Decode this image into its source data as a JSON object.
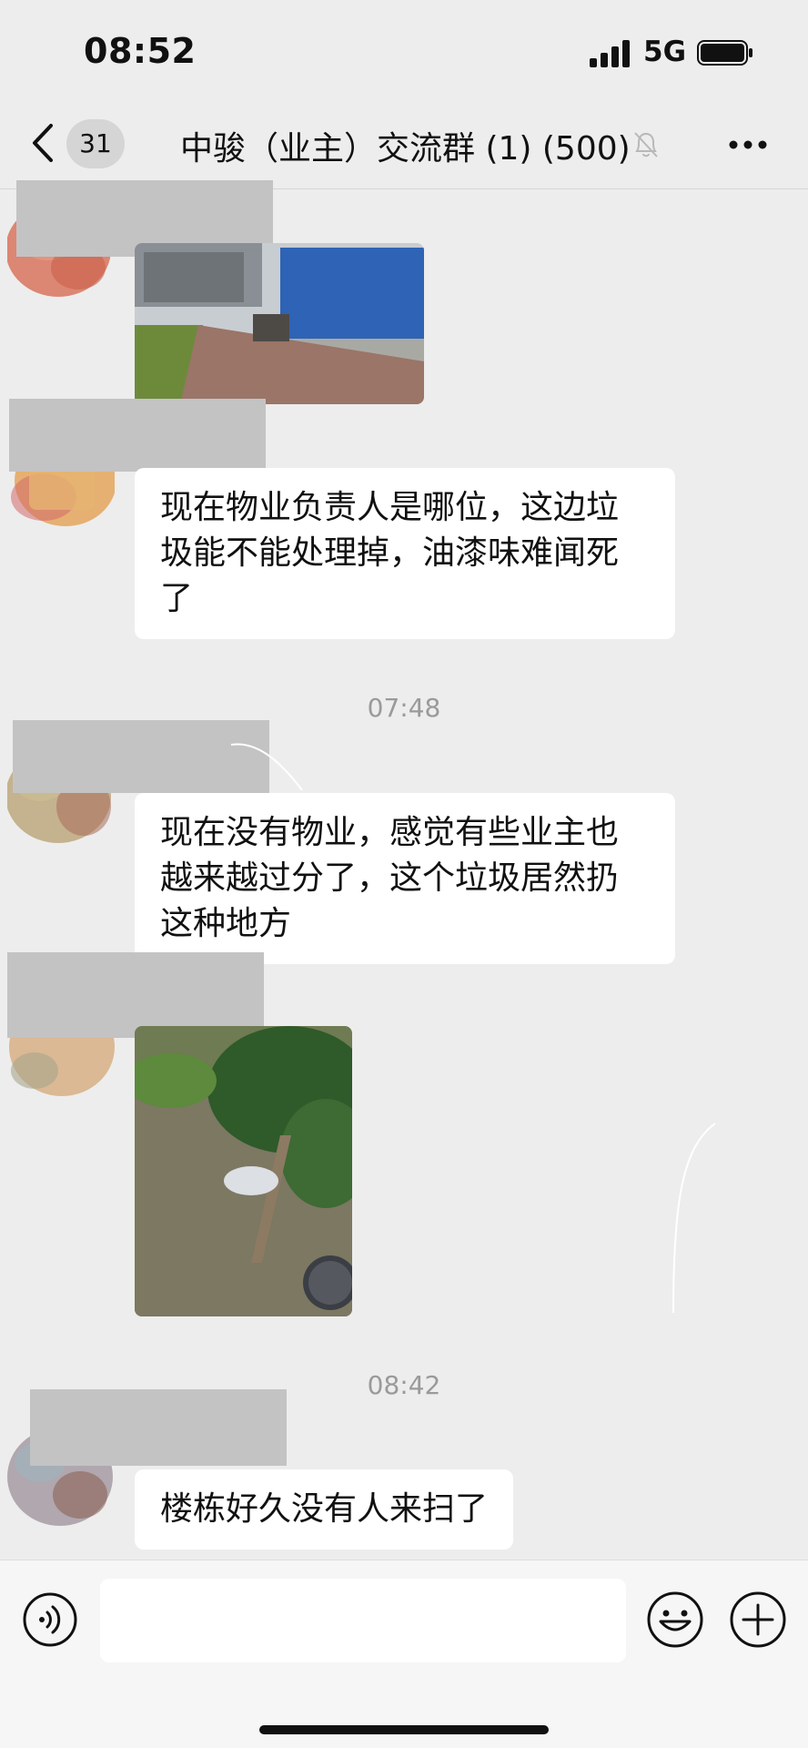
{
  "status_bar": {
    "time": "08:52",
    "network": "5G"
  },
  "nav": {
    "unread_count": "31",
    "title": "中骏（业主）交流群 (1) (500)",
    "icons": {
      "back": "chevron-left-icon",
      "mute": "bell-slash-icon",
      "more": "ellipsis-icon"
    }
  },
  "messages": [
    {
      "type": "image",
      "description_icon": "photo-icon"
    },
    {
      "type": "text",
      "text": "现在物业负责人是哪位，这边垃圾能不能处理掉，油漆味难闻死了"
    },
    {
      "type": "timestamp",
      "text": "07:48"
    },
    {
      "type": "text",
      "text": "现在没有物业，感觉有些业主也越来越过分了，这个垃圾居然扔这种地方"
    },
    {
      "type": "image",
      "description_icon": "photo-icon"
    },
    {
      "type": "timestamp",
      "text": "08:42"
    },
    {
      "type": "text",
      "text": "楼栋好久没有人来扫了"
    }
  ],
  "input_bar": {
    "message_value": "",
    "icons": {
      "voice": "voice-icon",
      "emoji": "emoji-icon",
      "more": "plus-icon"
    }
  },
  "colors": {
    "background": "#ededed",
    "bubble": "#ffffff",
    "name_mask": "#c3c3c3"
  }
}
